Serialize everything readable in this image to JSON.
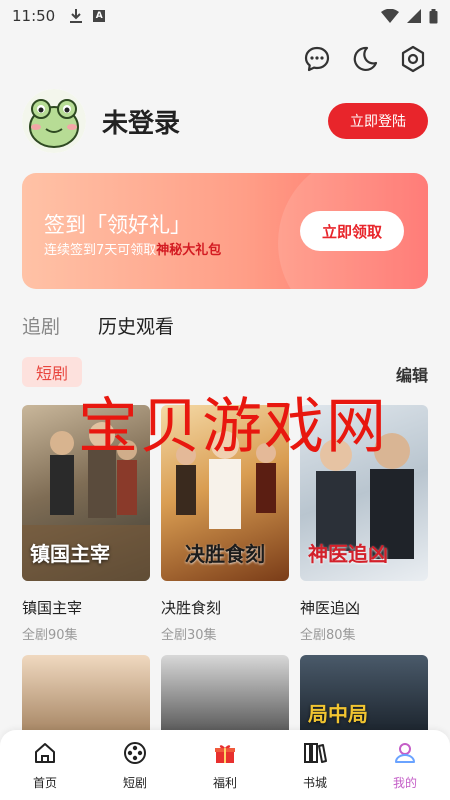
{
  "status": {
    "time": "11:50"
  },
  "profile": {
    "username": "未登录",
    "login_label": "立即登陆"
  },
  "banner": {
    "title": "签到「领好礼」",
    "subtitle_prefix": "连续签到7天可领取",
    "subtitle_highlight": "神秘大礼包",
    "button_label": "立即领取"
  },
  "tabs": [
    {
      "label": "追剧"
    },
    {
      "label": "历史观看"
    }
  ],
  "section": {
    "tag": "短剧",
    "edit_label": "编辑"
  },
  "watermark": "宝贝游戏网",
  "dramas": [
    {
      "name": "镇国主宰",
      "episodes": "全剧90集",
      "poster_text": "镇国主宰"
    },
    {
      "name": "决胜食刻",
      "episodes": "全剧30集",
      "poster_text": "决胜食刻"
    },
    {
      "name": "神医追凶",
      "episodes": "全剧80集",
      "poster_text": "神医追凶"
    }
  ],
  "row2_posters": [
    {
      "poster_text": ""
    },
    {
      "poster_text": ""
    },
    {
      "poster_text": "局中局"
    }
  ],
  "nav": [
    {
      "label": "首页",
      "icon": "home-icon"
    },
    {
      "label": "短剧",
      "icon": "film-reel-icon"
    },
    {
      "label": "福利",
      "icon": "gift-icon"
    },
    {
      "label": "书城",
      "icon": "books-icon"
    },
    {
      "label": "我的",
      "icon": "profile-icon"
    }
  ],
  "colors": {
    "accent": "#e8252b",
    "active_nav": "#c45ec7",
    "tag_bg": "#fde1dd"
  }
}
